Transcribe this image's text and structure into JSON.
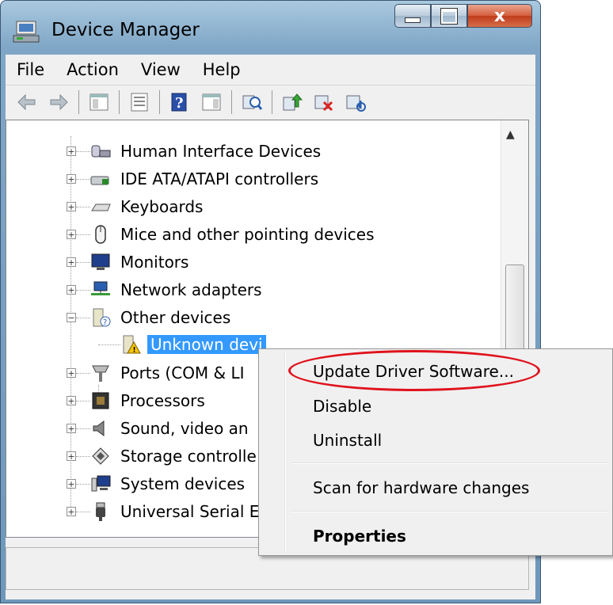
{
  "window": {
    "title": "Device Manager",
    "close_glyph": "x"
  },
  "menubar": {
    "items": [
      "File",
      "Action",
      "View",
      "Help"
    ]
  },
  "toolbar": {
    "buttons": [
      "back-arrow-icon",
      "forward-arrow-icon",
      "show-hide-console-tree-icon",
      "properties-icon",
      "help-icon",
      "show-action-pane-icon",
      "scan-hardware-icon",
      "update-driver-icon",
      "uninstall-icon",
      "disable-icon"
    ]
  },
  "tree": {
    "nodes": [
      {
        "label": "Human Interface Devices",
        "expander": "+"
      },
      {
        "label": "IDE ATA/ATAPI controllers",
        "expander": "+"
      },
      {
        "label": "Keyboards",
        "expander": "+"
      },
      {
        "label": "Mice and other pointing devices",
        "expander": "+"
      },
      {
        "label": "Monitors",
        "expander": "+"
      },
      {
        "label": "Network adapters",
        "expander": "+"
      },
      {
        "label": "Other devices",
        "expander": "−"
      },
      {
        "label": "Unknown device",
        "selected": true
      },
      {
        "label": "Ports (COM & LPT)",
        "expander": "+"
      },
      {
        "label": "Processors",
        "expander": "+"
      },
      {
        "label": "Sound, video and game controllers",
        "expander": "+"
      },
      {
        "label": "Storage controllers",
        "expander": "+"
      },
      {
        "label": "System devices",
        "expander": "+"
      },
      {
        "label": "Universal Serial Bus controllers",
        "expander": "+"
      }
    ],
    "visible_labels": [
      "Human Interface Devices",
      "IDE ATA/ATAPI controllers",
      "Keyboards",
      "Mice and other pointing devices",
      "Monitors",
      "Network adapters",
      "Other devices",
      "Unknown devi",
      "Ports (COM & LI",
      "Processors",
      "Sound, video an",
      "Storage controlle",
      "System devices",
      "Universal Serial E"
    ]
  },
  "context_menu": {
    "items": [
      {
        "label": "Update Driver Software...",
        "bold": false
      },
      {
        "label": "Disable",
        "bold": false
      },
      {
        "label": "Uninstall",
        "bold": false
      },
      {
        "label": "Scan for hardware changes",
        "bold": false
      },
      {
        "label": "Properties",
        "bold": true
      }
    ]
  },
  "colors": {
    "selection": "#3399ff",
    "annotation_ring": "#e0121c",
    "title_gradient_top": "#a9c9df"
  }
}
